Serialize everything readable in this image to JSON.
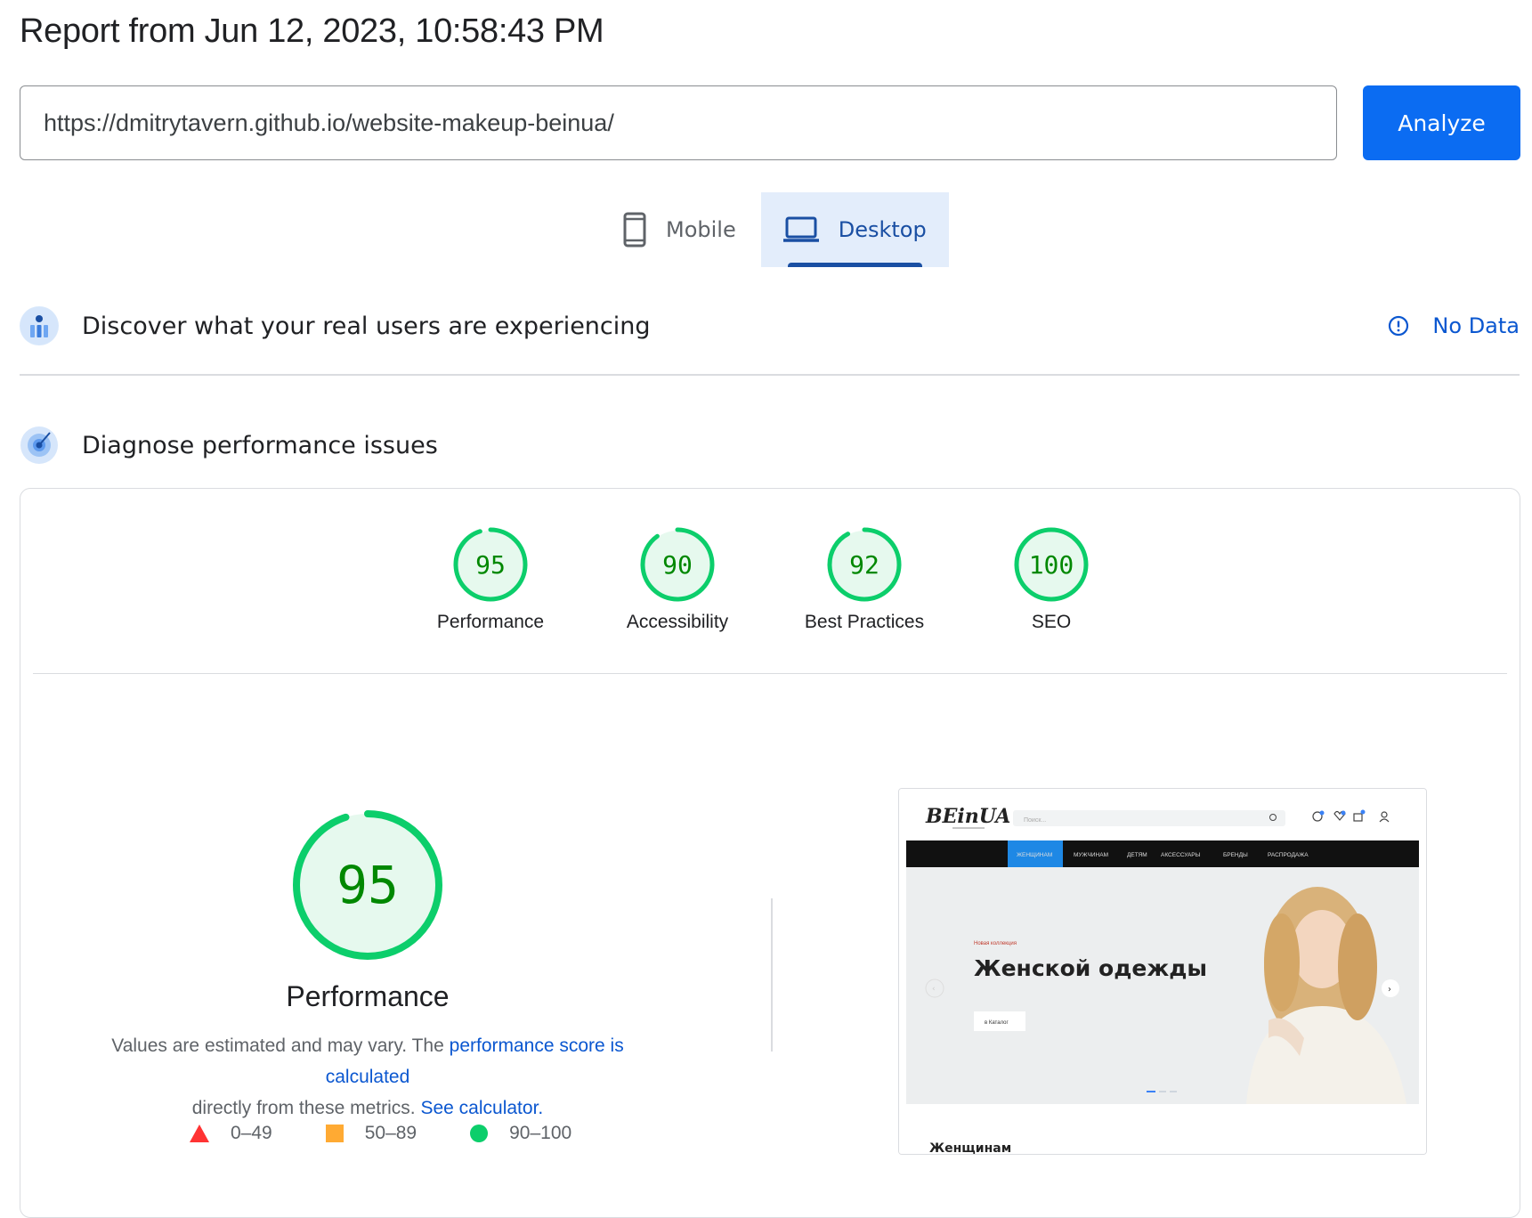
{
  "report": {
    "title": "Report from Jun 12, 2023, 10:58:43 PM"
  },
  "search": {
    "url": "https://dmitrytavern.github.io/website-makeup-beinua/",
    "analyze_label": "Analyze"
  },
  "tabs": [
    {
      "label": "Mobile",
      "icon": "smartphone-icon",
      "active": false
    },
    {
      "label": "Desktop",
      "icon": "laptop-icon",
      "active": true
    }
  ],
  "crux": {
    "title": "Discover what your real users are experiencing",
    "status": "No Data"
  },
  "diagnose": {
    "title": "Diagnose performance issues"
  },
  "scores": [
    {
      "label": "Performance",
      "value": "95"
    },
    {
      "label": "Accessibility",
      "value": "90"
    },
    {
      "label": "Best Practices",
      "value": "92"
    },
    {
      "label": "SEO",
      "value": "100"
    }
  ],
  "performance": {
    "score": "95",
    "label": "Performance",
    "desc_pre": "Values are estimated and may vary. The",
    "desc_link": "performance score is calculated",
    "desc_mid": "directly from these metrics.",
    "desc_link2": "See calculator."
  },
  "legend": [
    {
      "shape": "triangle",
      "range": "0–49",
      "color": "#ff3333"
    },
    {
      "shape": "square",
      "range": "50–89",
      "color": "#ffaa33"
    },
    {
      "shape": "circle",
      "range": "90–100",
      "color": "#0cce6b"
    }
  ],
  "colors": {
    "pass": "#0cce6b",
    "pass_text": "#008800",
    "pass_bg": "#e6f9ee",
    "link": "#0b57d0",
    "primary_btn": "#0b6cf2"
  },
  "screenshot": {
    "logo": "BEinUA",
    "search_placeholder": "Поиск...",
    "nav": [
      "ЖЕНЩИНАМ",
      "МУЖЧИНАМ",
      "ДЕТЯМ",
      "АКСЕССУАРЫ",
      "БРЕНДЫ",
      "РАСПРОДАЖА"
    ],
    "kicker": "Новая коллекция",
    "headline": "Женской одежды",
    "cta": "в Каталог",
    "footer_heading": "Женщинам"
  }
}
